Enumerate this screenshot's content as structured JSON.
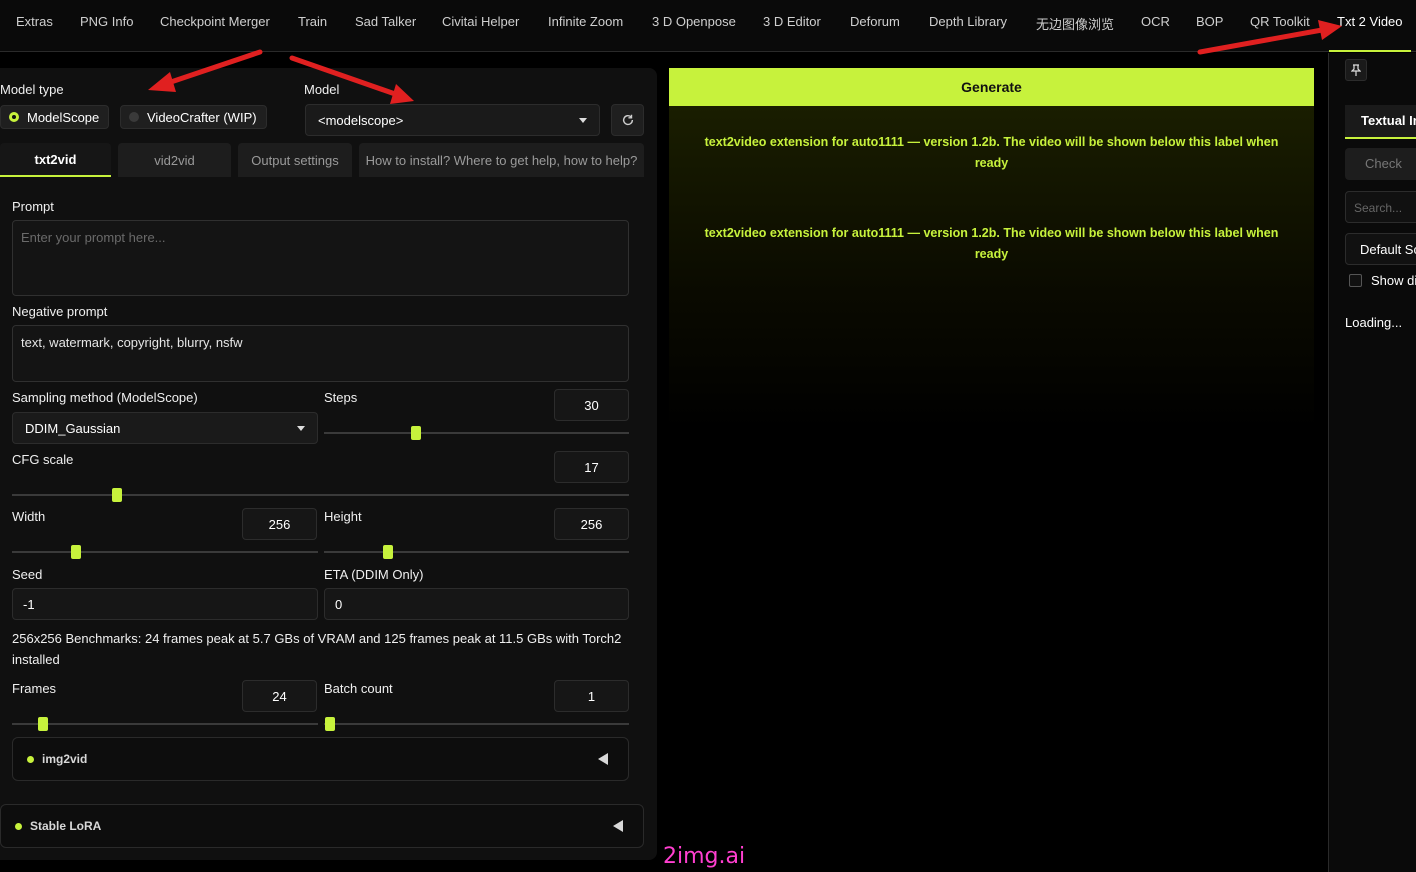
{
  "top_nav": {
    "tabs": [
      "Extras",
      "PNG Info",
      "Checkpoint Merger",
      "Train",
      "Sad Talker",
      "Civitai Helper",
      "Infinite Zoom",
      "3 D Openpose",
      "3 D Editor",
      "Deforum",
      "Depth Library",
      "无边图像浏览",
      "OCR",
      "BOP",
      "QR Toolkit",
      "Txt 2 Video"
    ],
    "active": "Txt 2 Video"
  },
  "left": {
    "model_type_label": "Model type",
    "model_type_options": [
      "ModelScope",
      "VideoCrafter (WIP)"
    ],
    "model_type_selected": "ModelScope",
    "model_label": "Model",
    "model_value": "<modelscope>",
    "refresh_icon": "refresh-icon",
    "subtabs": [
      "txt2vid",
      "vid2vid",
      "Output settings",
      "How to install? Where to get help, how to help?"
    ],
    "active_subtab": "txt2vid",
    "prompt_label": "Prompt",
    "prompt_placeholder": "Enter your prompt here...",
    "negative_label": "Negative prompt",
    "negative_value": "text, watermark, copyright, blurry, nsfw",
    "sampler_label": "Sampling method (ModelScope)",
    "sampler_value": "DDIM_Gaussian",
    "steps_label": "Steps",
    "steps_value": "30",
    "steps_slider_fraction": 0.3,
    "cfg_label": "CFG scale",
    "cfg_value": "17",
    "cfg_slider_fraction": 0.17,
    "width_label": "Width",
    "width_value": "256",
    "width_slider_fraction": 0.21,
    "height_label": "Height",
    "height_value": "256",
    "height_slider_fraction": 0.21,
    "seed_label": "Seed",
    "seed_value": "-1",
    "eta_label": "ETA (DDIM Only)",
    "eta_value": "0",
    "benchmark_text": "256x256 Benchmarks: 24 frames peak at 5.7 GBs of VRAM and 125 frames peak at 11.5 GBs with Torch2 installed",
    "frames_label": "Frames",
    "frames_value": "24",
    "frames_slider_fraction": 0.1,
    "batch_label": "Batch count",
    "batch_value": "1",
    "batch_slider_fraction": 0.02,
    "img2vid_label": "img2vid",
    "stable_lora_label": "Stable LoRA"
  },
  "center": {
    "generate_label": "Generate",
    "notice_1": "text2video extension for auto1111 — version 1.2b. The video will be shown below this label when ready",
    "notice_2": "text2video extension for auto1111 — version 1.2b. The video will be shown below this label when ready"
  },
  "right": {
    "pin_icon": "pin-icon",
    "tab_label": "Textual Inversion",
    "check_button": "Check",
    "search_placeholder": "Search...",
    "default_sort": "Default Sort",
    "show_dirs_label": "Show dirs",
    "loading_text": "Loading..."
  },
  "watermark": "2img.ai",
  "colors": {
    "accent": "#c7f23c",
    "background": "#000000",
    "panel": "#101010",
    "annotation_arrow": "#e02020",
    "watermark": "#ff3fd0"
  }
}
